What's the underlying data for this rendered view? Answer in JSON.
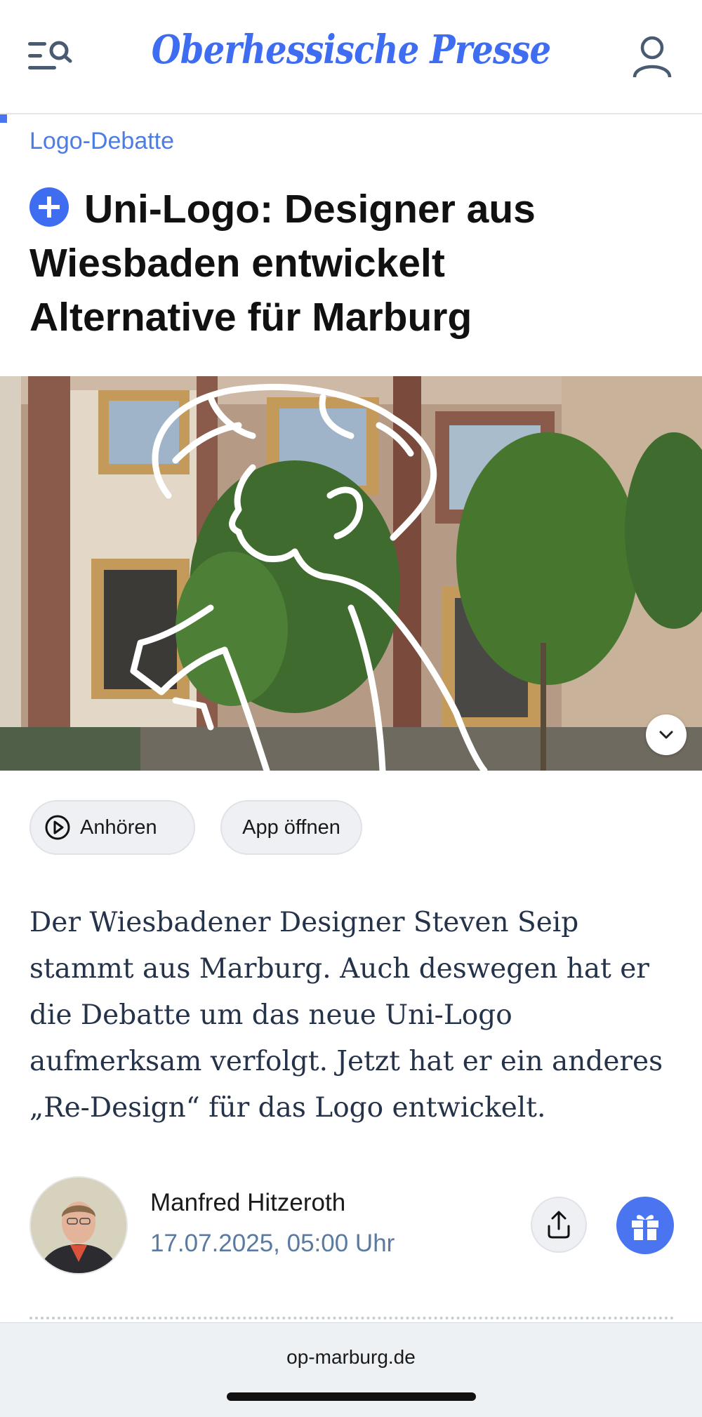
{
  "header": {
    "logo_text": "Oberhessische Presse",
    "menu_icon": "menu-search-icon",
    "user_icon": "user-icon"
  },
  "article": {
    "kicker": "Logo-Debatte",
    "headline": "Uni-Logo: Designer aus Wiesbaden entwickelt Alternative für Marburg",
    "badge_icon": "plus-icon",
    "lead": "Der Wiesbadener Designer Steven Seip stammt aus Marburg. Auch deswegen hat er die Debatte um das neue Uni-Logo aufmerksam verfolgt. Jetzt hat er ein anderes „Re-Design“ für das Logo entwickelt."
  },
  "actions": {
    "listen_label": "Anhören",
    "app_label": "App öffnen"
  },
  "author": {
    "name": "Manfred Hitzeroth",
    "date": "17.07.2025, 05:00 Uhr"
  },
  "browser": {
    "url": "op-marburg.de"
  },
  "colors": {
    "accent": "#3f6df2",
    "kicker": "#4b7de6",
    "lead_text": "#25334a",
    "date_text": "#5a7aa0"
  }
}
